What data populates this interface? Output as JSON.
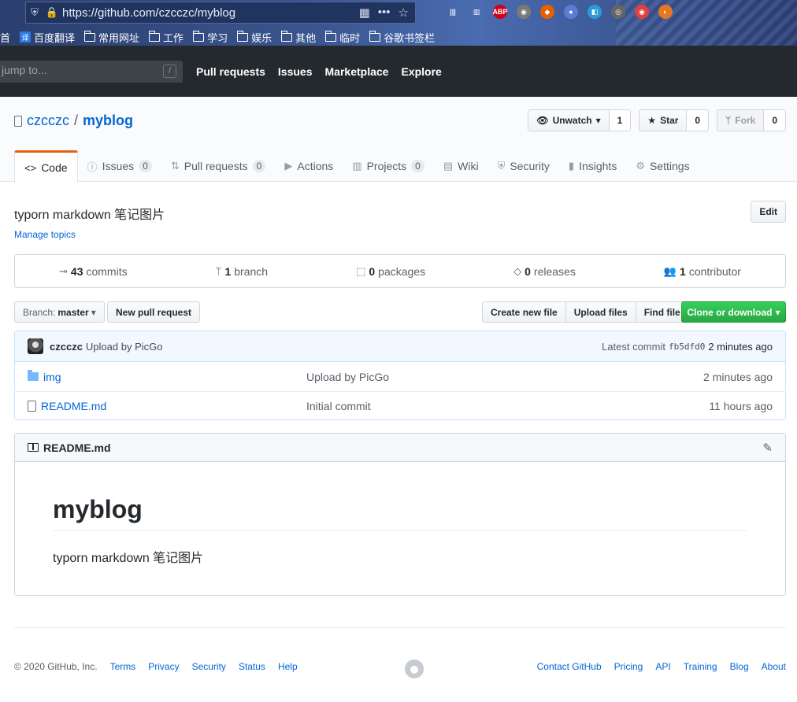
{
  "browser": {
    "url": "https://github.com/czcczc/myblog",
    "bookmarks": [
      "首",
      "百度翻译",
      "常用网址",
      "工作",
      "学习",
      "娱乐",
      "其他",
      "临时",
      "谷歌书签栏"
    ],
    "fanyi_glyph": "译",
    "extensions": [
      {
        "name": "library-icon",
        "color": "#ffffff",
        "label": "|||"
      },
      {
        "name": "sidebar-icon",
        "color": "#ffffff",
        "label": "▥"
      },
      {
        "name": "abp-icon",
        "color": "#d0021b",
        "label": "ABP"
      },
      {
        "name": "extension-icon",
        "color": "#7a7a7a",
        "label": "◉"
      },
      {
        "name": "fox-icon",
        "color": "#e66000",
        "label": "◆"
      },
      {
        "name": "owl-icon",
        "color": "#5b7bd5",
        "label": "●"
      },
      {
        "name": "translate-icon",
        "color": "#2b9bd8",
        "label": "◧"
      },
      {
        "name": "camera-icon",
        "color": "#666666",
        "label": "◎"
      },
      {
        "name": "record-icon",
        "color": "#e04040",
        "label": "◉"
      },
      {
        "name": "clock-icon",
        "color": "#e87722",
        "label": "◐"
      }
    ]
  },
  "gh": {
    "search_placeholder": "jump to...",
    "search_key": "/",
    "nav": [
      "Pull requests",
      "Issues",
      "Marketplace",
      "Explore"
    ]
  },
  "repo": {
    "owner": "czcczc",
    "separator": "/",
    "name": "myblog",
    "watch_label": "Unwatch",
    "watch_count": "1",
    "star_label": "Star",
    "star_count": "0",
    "fork_label": "Fork",
    "fork_count": "0"
  },
  "tabs": [
    {
      "label": "Code",
      "icon": "<>",
      "count": null
    },
    {
      "label": "Issues",
      "icon": "ⓘ",
      "count": "0"
    },
    {
      "label": "Pull requests",
      "icon": "⇅",
      "count": "0"
    },
    {
      "label": "Actions",
      "icon": "▶",
      "count": null
    },
    {
      "label": "Projects",
      "icon": "▥",
      "count": "0"
    },
    {
      "label": "Wiki",
      "icon": "▤",
      "count": null
    },
    {
      "label": "Security",
      "icon": "⛨",
      "count": null
    },
    {
      "label": "Insights",
      "icon": "▮",
      "count": null
    },
    {
      "label": "Settings",
      "icon": "⚙",
      "count": null
    }
  ],
  "description": "typorn markdown 笔记图片",
  "manage_topics": "Manage topics",
  "edit_label": "Edit",
  "summary": [
    {
      "num": "43",
      "label": "commits",
      "icon": "⊸"
    },
    {
      "num": "1",
      "label": "branch",
      "icon": "ᛘ"
    },
    {
      "num": "0",
      "label": "packages",
      "icon": "⬚"
    },
    {
      "num": "0",
      "label": "releases",
      "icon": "◇"
    },
    {
      "num": "1",
      "label": "contributor",
      "icon": "👥"
    }
  ],
  "branch": {
    "prefix": "Branch:",
    "name": "master",
    "caret": "▾"
  },
  "new_pr_label": "New pull request",
  "file_actions": [
    "Create new file",
    "Upload files",
    "Find file"
  ],
  "clone_label": "Clone or download",
  "clone_caret": "▾",
  "commit": {
    "author": "czcczc",
    "message": "Upload by PicGo",
    "latest_label": "Latest commit",
    "sha": "fb5dfd0",
    "age": "2 minutes ago"
  },
  "files": [
    {
      "name": "img",
      "type": "dir",
      "message": "Upload by PicGo",
      "age": "2 minutes ago"
    },
    {
      "name": "README.md",
      "type": "file",
      "message": "Initial commit",
      "age": "11 hours ago"
    }
  ],
  "readme": {
    "filename": "README.md",
    "heading": "myblog",
    "text": "typorn markdown 笔记图片"
  },
  "footer": {
    "copyright": "© 2020 GitHub, Inc.",
    "left_links": [
      "Terms",
      "Privacy",
      "Security",
      "Status",
      "Help"
    ],
    "right_links": [
      "Contact GitHub",
      "Pricing",
      "API",
      "Training",
      "Blog",
      "About"
    ]
  }
}
